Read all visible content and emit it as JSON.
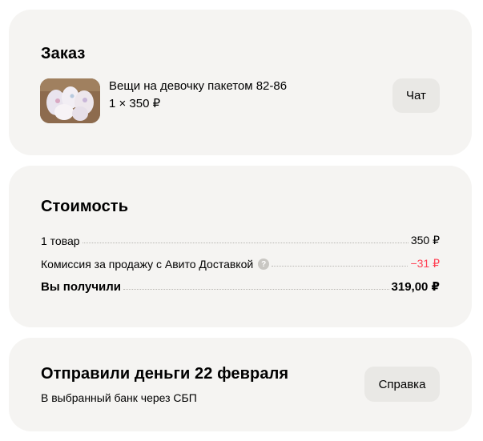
{
  "order": {
    "title": "Заказ",
    "item_name": "Вещи на девочку пакетом 82-86",
    "item_qty": "1 × 350 ₽",
    "chat_label": "Чат"
  },
  "cost": {
    "title": "Стоимость",
    "rows": [
      {
        "label": "1 товар",
        "value": "350 ₽"
      },
      {
        "label": "Комиссия за продажу с Авито Доставкой",
        "value": "−31 ₽",
        "help_icon": "question-icon"
      },
      {
        "label": "Вы получили",
        "value": "319,00 ₽"
      }
    ],
    "help_glyph": "?"
  },
  "payout": {
    "title": "Отправили деньги 22 февраля",
    "subtitle": "В выбранный банк через СБП",
    "help_label": "Справка"
  },
  "colors": {
    "card_bg": "#f5f4f2",
    "button_bg": "#e9e8e5",
    "negative": "#ff4053"
  }
}
